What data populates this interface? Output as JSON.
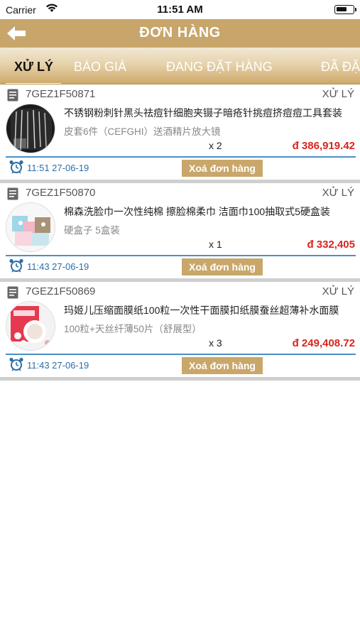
{
  "status_bar": {
    "carrier": "Carrier",
    "time": "11:51 AM"
  },
  "header": {
    "title": "ĐƠN HÀNG",
    "back_icon": "arrow-left-icon"
  },
  "tabs": [
    {
      "label": "XỬ LÝ",
      "active": true
    },
    {
      "label": "BÁO GIÁ",
      "active": false
    },
    {
      "label": "ĐANG ĐẶT HÀNG",
      "active": false
    },
    {
      "label": "ĐÃ ĐẶ",
      "active": false
    }
  ],
  "orders": [
    {
      "code": "7GEZ1F50871",
      "status": "XỬ LÝ",
      "name": "不锈钢粉刺针黑头祛痘针细胞夹镊子暗疮针挑痘挤痘痘工具套装",
      "variant": "皮套6件（CEFGHI）送酒精片放大镜",
      "quantity": "x 2",
      "price": "đ 386,919.42",
      "datetime": "11:51 27-06-19",
      "delete_label": "Xoá đơn hàng"
    },
    {
      "code": "7GEZ1F50870",
      "status": "XỬ LÝ",
      "name": "棉森洗脸巾一次性纯棉 擦脸棉柔巾 洁面巾100抽取式5硬盒装",
      "variant": "硬盒子  5盒装",
      "quantity": "x 1",
      "price": "đ 332,405",
      "datetime": "11:43 27-06-19",
      "delete_label": "Xoá đơn hàng"
    },
    {
      "code": "7GEZ1F50869",
      "status": "XỬ LÝ",
      "name": "玛姬儿压缩面膜纸100粒一次性干面膜扣纸膜蚕丝超薄补水面膜",
      "variant": "100粒+天丝纤薄50片（舒展型）",
      "quantity": "x 3",
      "price": "đ 249,408.72",
      "datetime": "11:43 27-06-19",
      "delete_label": "Xoá đơn hàng"
    }
  ],
  "colors": {
    "brand_gold": "#c8a56a",
    "price_red": "#d9251d",
    "date_blue": "#2b6ea6"
  }
}
